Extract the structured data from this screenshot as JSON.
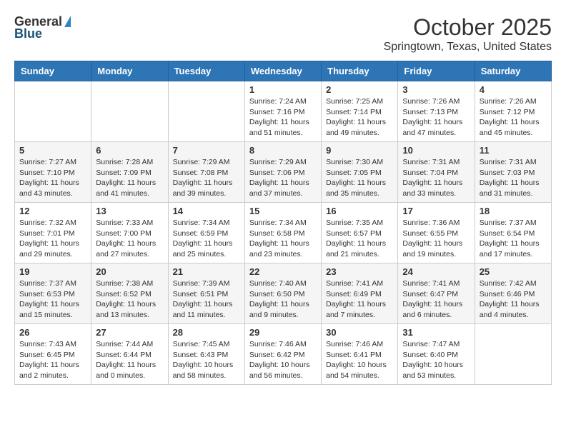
{
  "logo": {
    "general": "General",
    "blue": "Blue"
  },
  "title": "October 2025",
  "location": "Springtown, Texas, United States",
  "days_of_week": [
    "Sunday",
    "Monday",
    "Tuesday",
    "Wednesday",
    "Thursday",
    "Friday",
    "Saturday"
  ],
  "weeks": [
    [
      {
        "day": "",
        "info": ""
      },
      {
        "day": "",
        "info": ""
      },
      {
        "day": "",
        "info": ""
      },
      {
        "day": "1",
        "info": "Sunrise: 7:24 AM\nSunset: 7:16 PM\nDaylight: 11 hours\nand 51 minutes."
      },
      {
        "day": "2",
        "info": "Sunrise: 7:25 AM\nSunset: 7:14 PM\nDaylight: 11 hours\nand 49 minutes."
      },
      {
        "day": "3",
        "info": "Sunrise: 7:26 AM\nSunset: 7:13 PM\nDaylight: 11 hours\nand 47 minutes."
      },
      {
        "day": "4",
        "info": "Sunrise: 7:26 AM\nSunset: 7:12 PM\nDaylight: 11 hours\nand 45 minutes."
      }
    ],
    [
      {
        "day": "5",
        "info": "Sunrise: 7:27 AM\nSunset: 7:10 PM\nDaylight: 11 hours\nand 43 minutes."
      },
      {
        "day": "6",
        "info": "Sunrise: 7:28 AM\nSunset: 7:09 PM\nDaylight: 11 hours\nand 41 minutes."
      },
      {
        "day": "7",
        "info": "Sunrise: 7:29 AM\nSunset: 7:08 PM\nDaylight: 11 hours\nand 39 minutes."
      },
      {
        "day": "8",
        "info": "Sunrise: 7:29 AM\nSunset: 7:06 PM\nDaylight: 11 hours\nand 37 minutes."
      },
      {
        "day": "9",
        "info": "Sunrise: 7:30 AM\nSunset: 7:05 PM\nDaylight: 11 hours\nand 35 minutes."
      },
      {
        "day": "10",
        "info": "Sunrise: 7:31 AM\nSunset: 7:04 PM\nDaylight: 11 hours\nand 33 minutes."
      },
      {
        "day": "11",
        "info": "Sunrise: 7:31 AM\nSunset: 7:03 PM\nDaylight: 11 hours\nand 31 minutes."
      }
    ],
    [
      {
        "day": "12",
        "info": "Sunrise: 7:32 AM\nSunset: 7:01 PM\nDaylight: 11 hours\nand 29 minutes."
      },
      {
        "day": "13",
        "info": "Sunrise: 7:33 AM\nSunset: 7:00 PM\nDaylight: 11 hours\nand 27 minutes."
      },
      {
        "day": "14",
        "info": "Sunrise: 7:34 AM\nSunset: 6:59 PM\nDaylight: 11 hours\nand 25 minutes."
      },
      {
        "day": "15",
        "info": "Sunrise: 7:34 AM\nSunset: 6:58 PM\nDaylight: 11 hours\nand 23 minutes."
      },
      {
        "day": "16",
        "info": "Sunrise: 7:35 AM\nSunset: 6:57 PM\nDaylight: 11 hours\nand 21 minutes."
      },
      {
        "day": "17",
        "info": "Sunrise: 7:36 AM\nSunset: 6:55 PM\nDaylight: 11 hours\nand 19 minutes."
      },
      {
        "day": "18",
        "info": "Sunrise: 7:37 AM\nSunset: 6:54 PM\nDaylight: 11 hours\nand 17 minutes."
      }
    ],
    [
      {
        "day": "19",
        "info": "Sunrise: 7:37 AM\nSunset: 6:53 PM\nDaylight: 11 hours\nand 15 minutes."
      },
      {
        "day": "20",
        "info": "Sunrise: 7:38 AM\nSunset: 6:52 PM\nDaylight: 11 hours\nand 13 minutes."
      },
      {
        "day": "21",
        "info": "Sunrise: 7:39 AM\nSunset: 6:51 PM\nDaylight: 11 hours\nand 11 minutes."
      },
      {
        "day": "22",
        "info": "Sunrise: 7:40 AM\nSunset: 6:50 PM\nDaylight: 11 hours\nand 9 minutes."
      },
      {
        "day": "23",
        "info": "Sunrise: 7:41 AM\nSunset: 6:49 PM\nDaylight: 11 hours\nand 7 minutes."
      },
      {
        "day": "24",
        "info": "Sunrise: 7:41 AM\nSunset: 6:47 PM\nDaylight: 11 hours\nand 6 minutes."
      },
      {
        "day": "25",
        "info": "Sunrise: 7:42 AM\nSunset: 6:46 PM\nDaylight: 11 hours\nand 4 minutes."
      }
    ],
    [
      {
        "day": "26",
        "info": "Sunrise: 7:43 AM\nSunset: 6:45 PM\nDaylight: 11 hours\nand 2 minutes."
      },
      {
        "day": "27",
        "info": "Sunrise: 7:44 AM\nSunset: 6:44 PM\nDaylight: 11 hours\nand 0 minutes."
      },
      {
        "day": "28",
        "info": "Sunrise: 7:45 AM\nSunset: 6:43 PM\nDaylight: 10 hours\nand 58 minutes."
      },
      {
        "day": "29",
        "info": "Sunrise: 7:46 AM\nSunset: 6:42 PM\nDaylight: 10 hours\nand 56 minutes."
      },
      {
        "day": "30",
        "info": "Sunrise: 7:46 AM\nSunset: 6:41 PM\nDaylight: 10 hours\nand 54 minutes."
      },
      {
        "day": "31",
        "info": "Sunrise: 7:47 AM\nSunset: 6:40 PM\nDaylight: 10 hours\nand 53 minutes."
      },
      {
        "day": "",
        "info": ""
      }
    ]
  ]
}
